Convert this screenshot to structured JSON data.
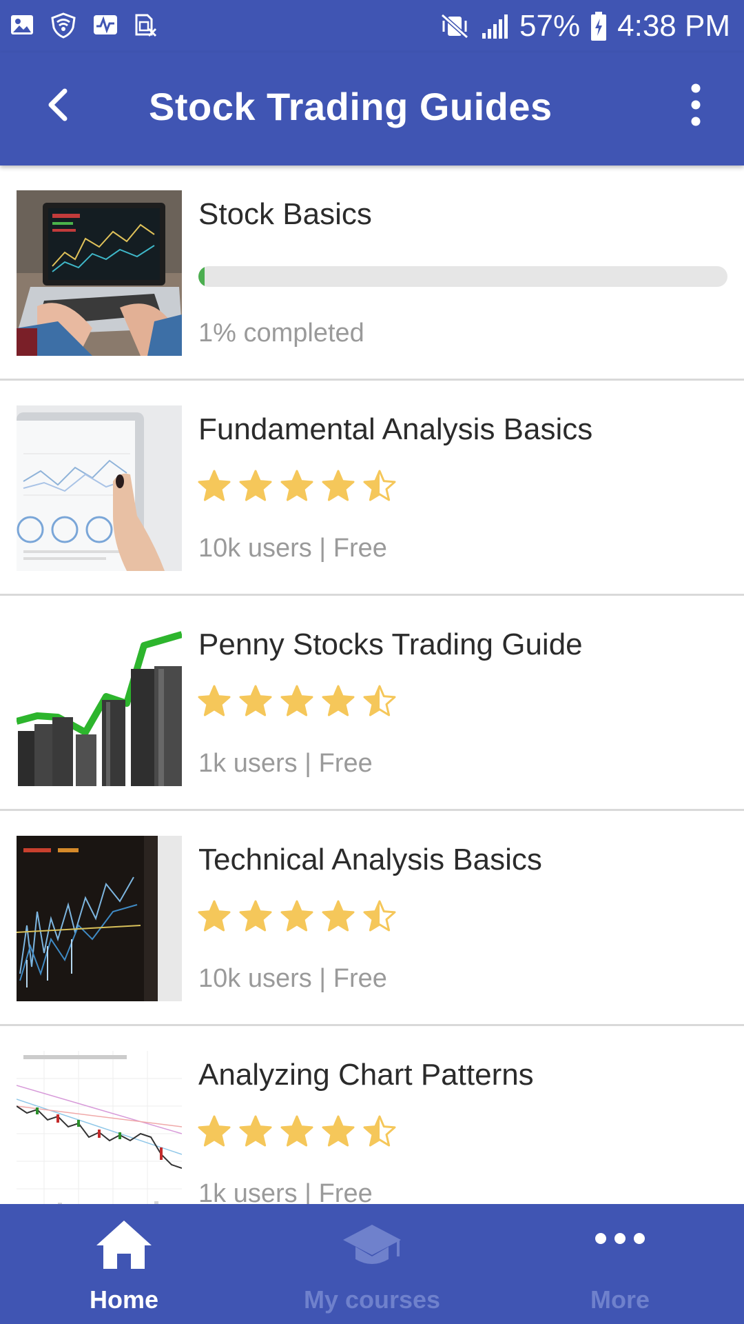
{
  "status_bar": {
    "left_icons": [
      "image-icon",
      "wifi-shield-icon",
      "activity-icon",
      "sim-icon"
    ],
    "battery": "57%",
    "time": "4:38 PM"
  },
  "app_bar": {
    "title": "Stock Trading Guides",
    "back_icon": "arrow-back-icon",
    "menu_icon": "more-vert-icon"
  },
  "courses": [
    {
      "title": "Stock Basics",
      "progress": 0.01,
      "progress_label": "1% completed",
      "thumb": "laptop-trading-image"
    },
    {
      "title": "Fundamental Analysis Basics",
      "rating": 4.5,
      "meta": "10k users | Free",
      "thumb": "tablet-charts-image"
    },
    {
      "title": "Penny Stocks Trading Guide",
      "rating": 4.5,
      "meta": "1k users | Free",
      "thumb": "bar-growth-image"
    },
    {
      "title": "Technical Analysis Basics",
      "rating": 4.5,
      "meta": "10k users | Free",
      "thumb": "screen-chart-image"
    },
    {
      "title": "Analyzing Chart Patterns",
      "rating": 4.5,
      "meta": "1k users | Free",
      "thumb": "candlestick-chart-image"
    }
  ],
  "bottom_nav": [
    {
      "label": "Home",
      "icon": "home-icon",
      "active": true
    },
    {
      "label": "My courses",
      "icon": "graduation-cap-icon",
      "active": false
    },
    {
      "label": "More",
      "icon": "more-horiz-icon",
      "active": false
    }
  ],
  "colors": {
    "primary": "#4055b3",
    "star": "#f5c75a",
    "progress": "#4cae50",
    "nav_inactive": "#6f81cc"
  }
}
